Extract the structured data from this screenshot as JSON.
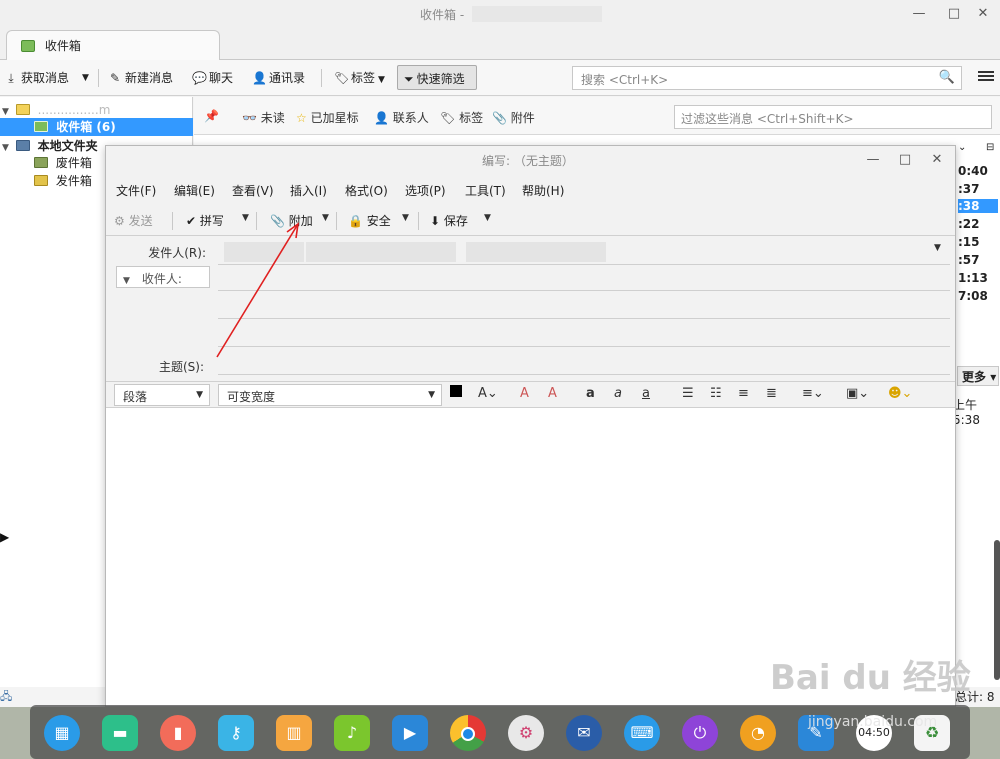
{
  "main_window": {
    "title": "收件箱 - ",
    "tab_label": "收件箱",
    "controls": {
      "minimize": "—",
      "maximize": "□",
      "close": "✕"
    }
  },
  "main_toolbar": {
    "get_mail": "获取消息",
    "new_message": "新建消息",
    "chat": "聊天",
    "address_book": "通讯录",
    "tags": "标签",
    "quick_filter": "快速筛选",
    "search_placeholder": "搜索 <Ctrl+K>"
  },
  "folders": {
    "account_name": "................m",
    "inbox": "收件箱 (6)",
    "local_folders": "本地文件夹",
    "trash": "废件箱",
    "outbox": "发件箱"
  },
  "filter_bar": {
    "unread": "未读",
    "starred": "已加星标",
    "contact": "联系人",
    "tags": "标签",
    "attachment": "附件",
    "filter_placeholder": "过滤这些消息 <Ctrl+Shift+K>"
  },
  "message_times": [
    "0:40",
    ":37",
    ":38",
    ":22",
    ":15",
    ":57",
    "1:13",
    "7:08"
  ],
  "more_button": "更多",
  "preview_time": "上午5:38",
  "total_label": "总计: 8",
  "compose": {
    "title": "编写: （无主题）",
    "menu": [
      "文件(F)",
      "编辑(E)",
      "查看(V)",
      "插入(I)",
      "格式(O)",
      "选项(P)",
      "工具(T)",
      "帮助(H)"
    ],
    "toolbar": {
      "send": "发送",
      "spell": "拼写",
      "attach": "附加",
      "security": "安全",
      "save": "保存"
    },
    "from_label": "发件人(R):",
    "to_type": "收件人:",
    "subject_label": "主题(S):",
    "paragraph_format": "段落",
    "font_select": "可变宽度",
    "text_color": "#000000"
  },
  "annotation_color": "#e02020",
  "dock_icons": [
    "launcher-icon",
    "terminal-icon",
    "video-icon",
    "files-icon",
    "store-icon",
    "music-icon",
    "movie-icon",
    "chrome-icon",
    "settings-icon",
    "thunderbird-icon",
    "keyboard-icon",
    "power-icon",
    "network-icon",
    "screenshot-icon",
    "clock-icon",
    "trash-icon"
  ],
  "dock_clock": "04:50",
  "watermark": {
    "brand": "Bai du 经验",
    "url": "jingyan.baidu.com"
  }
}
